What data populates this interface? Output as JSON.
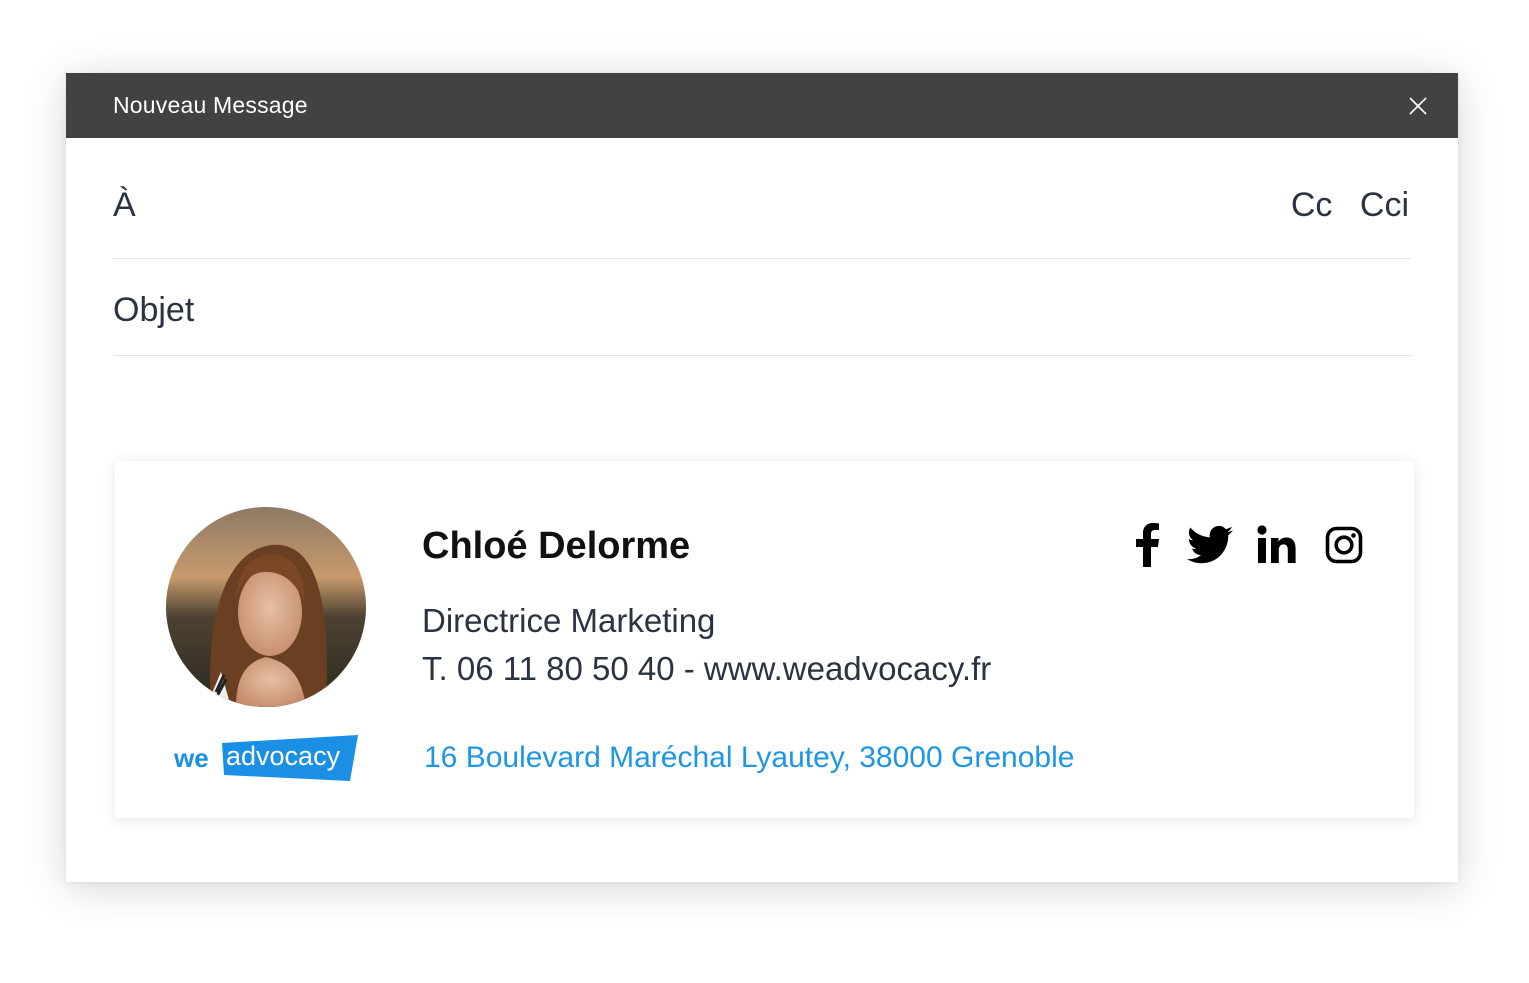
{
  "window": {
    "title": "Nouveau Message",
    "close_icon": "close-icon"
  },
  "fields": {
    "to_label": "À",
    "cc_label": "Cc",
    "bcc_label": "Cci",
    "subject_label": "Objet"
  },
  "signature": {
    "name": "Chloé Delorme",
    "role": "Directrice Marketing",
    "contact": "T. 06 11 80 50 40 - www.weadvocacy.fr",
    "address": "16 Boulevard Maréchal Lyautey, 38000 Grenoble",
    "logo": {
      "part1": "we",
      "part2": "advocacy"
    },
    "social_icons": [
      "facebook-icon",
      "twitter-icon",
      "linkedin-icon",
      "instagram-icon"
    ]
  },
  "colors": {
    "titlebar": "#424242",
    "address": "#1e96e6",
    "brand_blue": "#1a8fe3"
  }
}
